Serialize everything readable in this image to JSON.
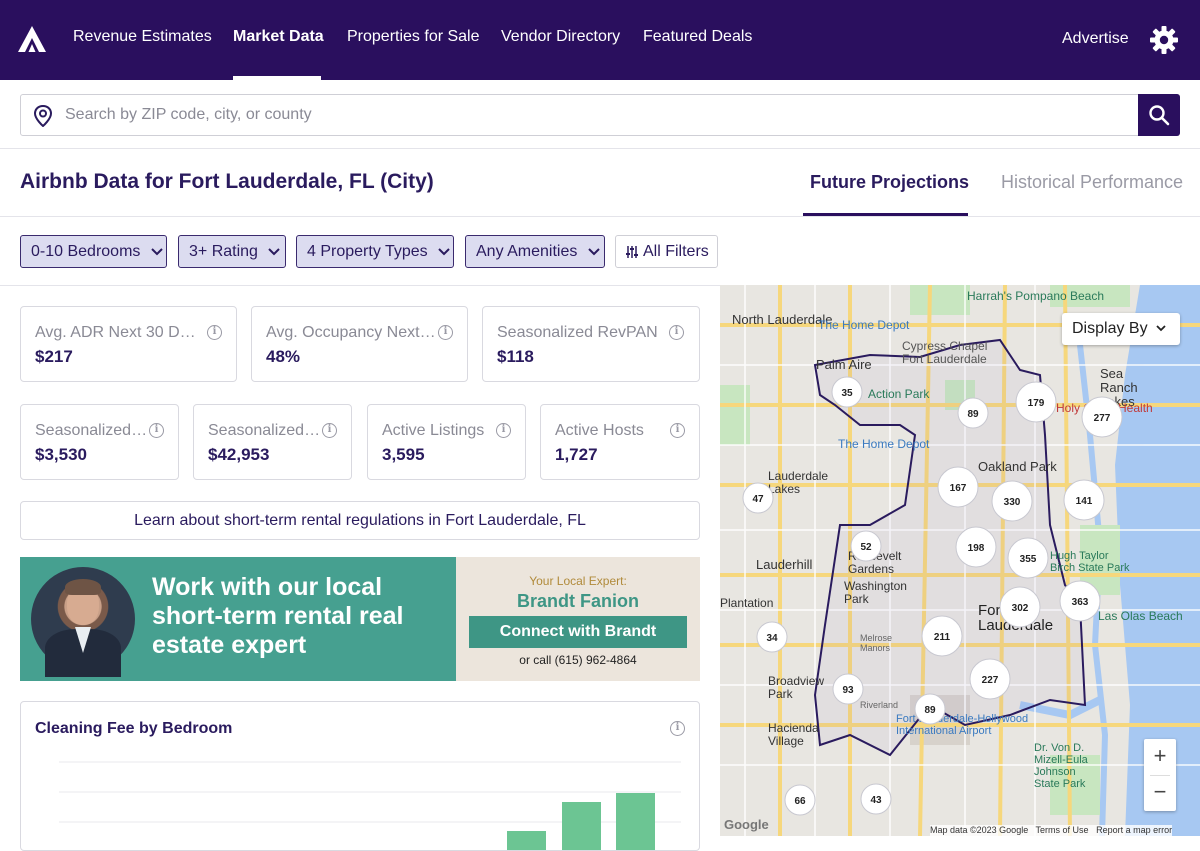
{
  "nav": {
    "logo_icon": "brand-logo",
    "items": [
      {
        "label": "Revenue Estimates"
      },
      {
        "label": "Market Data",
        "active": true
      },
      {
        "label": "Properties for Sale"
      },
      {
        "label": "Vendor Directory"
      },
      {
        "label": "Featured Deals"
      }
    ],
    "advertise": "Advertise",
    "settings_icon": "gear-icon"
  },
  "search": {
    "placeholder": "Search by ZIP code, city, or county",
    "value": ""
  },
  "page": {
    "title": "Airbnb Data for Fort Lauderdale, FL (City)"
  },
  "tabs": [
    {
      "label": "Future Projections",
      "active": true
    },
    {
      "label": "Historical Performance",
      "active": false
    }
  ],
  "filters": [
    {
      "label": "0-10 Bedrooms"
    },
    {
      "label": "3+ Rating"
    },
    {
      "label": "4 Property Types"
    },
    {
      "label": "Any Amenities"
    }
  ],
  "all_filters": "All Filters",
  "metrics": [
    {
      "label": "Avg. ADR Next 30 Days",
      "value": "$217"
    },
    {
      "label": "Avg. Occupancy Next …",
      "value": "48%"
    },
    {
      "label": "Seasonalized RevPAN",
      "value": "$118"
    },
    {
      "label": "Seasonalized …",
      "value": "$3,530"
    },
    {
      "label": "Seasonalized …",
      "value": "$42,953"
    },
    {
      "label": "Active Listings",
      "value": "3,595"
    },
    {
      "label": "Active Hosts",
      "value": "1,727"
    }
  ],
  "regulations_link": "Learn about short-term rental regulations in Fort Lauderdale, FL",
  "banner": {
    "headline": "Work with our local short-term rental real estate expert",
    "expert_label": "Your Local Expert:",
    "expert_name": "Brandt Fanion",
    "cta": "Connect with Brandt",
    "call": "or call (615) 962-4864"
  },
  "cleaning_chart": {
    "title": "Cleaning Fee by Bedroom",
    "bar_color": "#6cc593"
  },
  "map": {
    "display_by": "Display By",
    "zoom_in": "+",
    "zoom_out": "−",
    "footer": {
      "data": "Map data ©2023 Google",
      "terms": "Terms of Use",
      "report": "Report a map error"
    },
    "place_labels": [
      "North Lauderdale",
      "The Home Depot",
      "Harrah's Pompano Beach",
      "Palm Aire",
      "Cypress Chapel Fort Lauderdale",
      "Action Park",
      "Sea Ranch Lakes",
      "Holy Cross Health",
      "The Home Depot",
      "Lauderdale Lakes",
      "Oakland Park",
      "Lauderhill",
      "Roosevelt Gardens",
      "Washington Park",
      "Hugh Taylor Birch State Park",
      "Plantation",
      "Fort Lauderdale",
      "Las Olas Beach",
      "Broadview Park",
      "Hacienda Village",
      "Fort Lauderdale-Hollywood International Airport",
      "Dr. Von D. Mizell-Eula Johnson State Park",
      "Melrose Manors",
      "Riverland",
      "Google"
    ],
    "clusters": [
      "35",
      "89",
      "179",
      "277",
      "47",
      "167",
      "330",
      "141",
      "52",
      "198",
      "355",
      "302",
      "363",
      "34",
      "211",
      "227",
      "93",
      "89",
      "66",
      "43"
    ]
  }
}
